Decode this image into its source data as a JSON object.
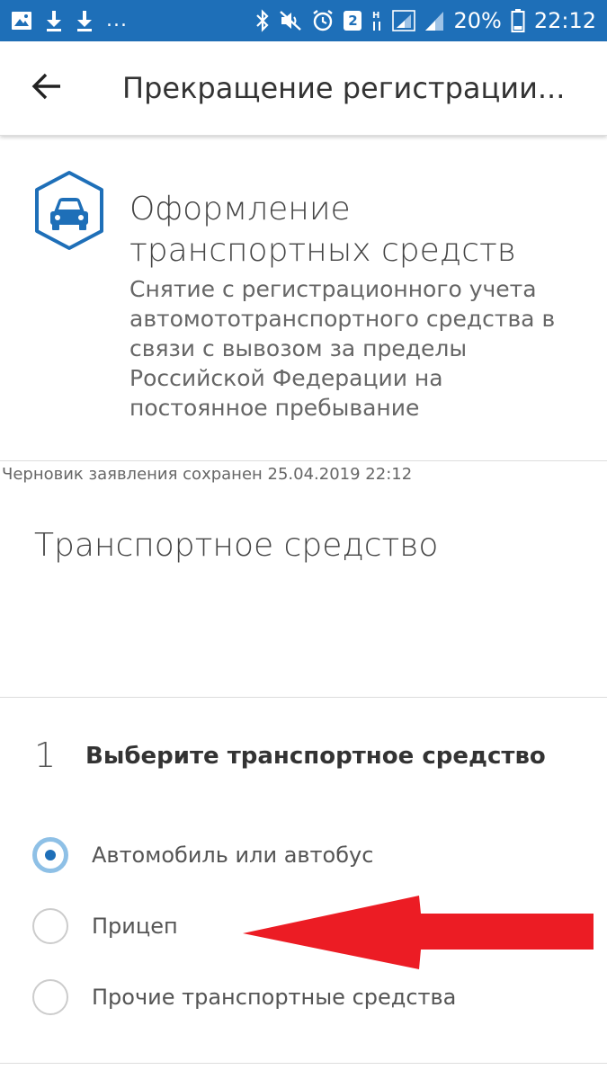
{
  "status_bar": {
    "overflow": "...",
    "sim_badge": "2",
    "battery_percent": "20%",
    "time": "22:12",
    "icons": [
      "gallery-icon",
      "download-icon",
      "download-icon",
      "bluetooth-icon",
      "mute-icon",
      "alarm-icon",
      "sim-badge",
      "network-h-icon",
      "signal-icon",
      "signal-icon",
      "battery-icon"
    ]
  },
  "app_bar": {
    "back_icon": "arrow-left-icon",
    "title": "Прекращение регистрации..."
  },
  "service": {
    "icon": "car-icon",
    "icon_color": "#1e6fb8",
    "title": "Оформление транспортных средств",
    "description": "Снятие с регистрационного учета автомототранспортного средства в связи с вывозом за пределы Российской Федерации на постоянное пребывание"
  },
  "draft_note": "Черновик заявления сохранен 25.04.2019 22:12",
  "section": {
    "title": "Транспортное средство"
  },
  "step": {
    "number": "1",
    "title": "Выберите транспортное средство",
    "options": [
      {
        "label": "Автомобиль или автобус",
        "selected": true
      },
      {
        "label": "Прицеп",
        "selected": false
      },
      {
        "label": "Прочие транспортные средства",
        "selected": false
      }
    ]
  },
  "annotation": {
    "arrow_color": "#ec1c24"
  },
  "colors": {
    "primary": "#1e6fb8",
    "radio_ring": "#8ec0e6"
  }
}
